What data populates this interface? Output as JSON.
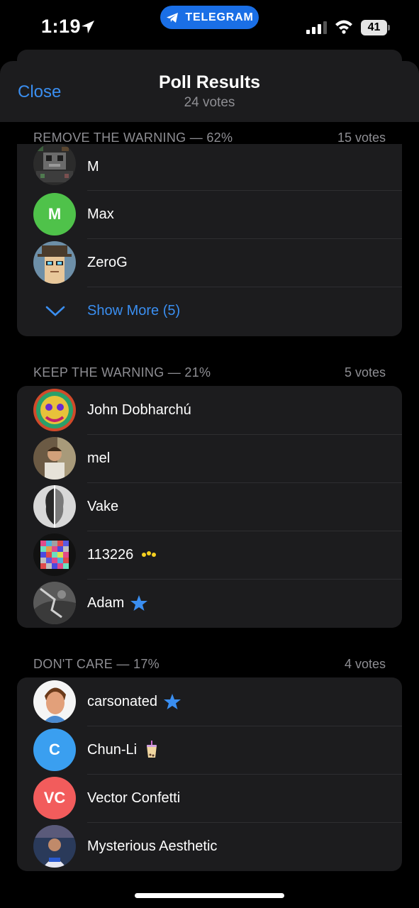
{
  "status_bar": {
    "time": "1:19",
    "pill_label": "TELEGRAM",
    "battery": "41"
  },
  "nav": {
    "close_label": "Close",
    "title": "Poll Results",
    "subtitle": "24 votes"
  },
  "sections": [
    {
      "title": "REMOVE THE WARNING — 62%",
      "count": "15 votes",
      "voters": [
        {
          "name": "M",
          "avatar": "pixel-art"
        },
        {
          "name": "Max",
          "avatar_initials": "M",
          "avatar_color": "#4fc24a"
        },
        {
          "name": "ZeroG",
          "avatar": "pixel-punk"
        }
      ],
      "show_more": "Show More (5)"
    },
    {
      "title": "KEEP THE WARNING — 21%",
      "count": "5 votes",
      "voters": [
        {
          "name": "John Dobharchú"
        },
        {
          "name": "mel"
        },
        {
          "name": "Vake"
        },
        {
          "name": "113226",
          "badge": "sparkle-emoji"
        },
        {
          "name": "Adam",
          "badge": "star-icon"
        }
      ]
    },
    {
      "title": "DON'T CARE — 17%",
      "count": "4 votes",
      "voters": [
        {
          "name": "carsonated",
          "badge": "star-icon"
        },
        {
          "name": "Chun-Li",
          "avatar_initials": "C",
          "avatar_color": "#3a9ff0",
          "badge": "bubble-tea-emoji"
        },
        {
          "name": "Vector Confetti",
          "avatar_initials": "VC",
          "avatar_color": "#f25c5c"
        },
        {
          "name": "Mysterious Aesthetic"
        }
      ]
    }
  ],
  "colors": {
    "accent": "#3a8ef0",
    "card": "#1c1c1e",
    "secondary_text": "#8e8e93",
    "telegram_pill": "#1a6fe6"
  }
}
